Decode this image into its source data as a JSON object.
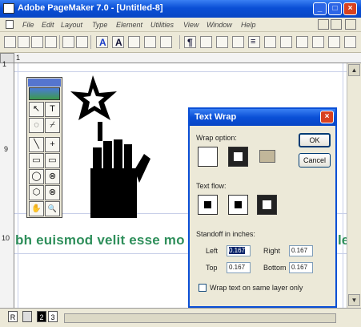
{
  "window": {
    "title": "Adobe PageMaker 7.0 - [Untitled-8]",
    "minimize_glyph": "_",
    "maximize_glyph": "□",
    "close_glyph": "×"
  },
  "menu": [
    "File",
    "Edit",
    "Layout",
    "Type",
    "Element",
    "Utilities",
    "View",
    "Window",
    "Help"
  ],
  "toolbar": {
    "glyphs": {
      "text_tool": "A",
      "bold_A": "A",
      "paragraph": "¶",
      "pilcrow_alt": "≡"
    }
  },
  "rulers": {
    "h_label": "1",
    "v_labels": [
      "1",
      "9",
      "10"
    ]
  },
  "toolbox": {
    "tools": [
      "↖",
      "T",
      "◌",
      "⌿",
      "╲",
      "+",
      "▭",
      "▭",
      "◯",
      "⊗",
      "⬡",
      "⊗",
      "✋",
      "🔍"
    ]
  },
  "document": {
    "body_text": "bh euismod velit esse mo",
    "body_text_right": "le"
  },
  "pages": {
    "labels": [
      "R",
      "2",
      "3"
    ]
  },
  "dialog": {
    "title": "Text Wrap",
    "close_glyph": "×",
    "wrap_option_label": "Wrap option:",
    "text_flow_label": "Text flow:",
    "standoff_label": "Standoff in inches:",
    "ok_label": "OK",
    "cancel_label": "Cancel",
    "fields": {
      "left": {
        "label": "Left",
        "value": "0.167"
      },
      "right": {
        "label": "Right",
        "value": "0.167"
      },
      "top": {
        "label": "Top",
        "value": "0.167"
      },
      "bottom": {
        "label": "Bottom",
        "value": "0.167"
      }
    },
    "checkbox_label": "Wrap text on same layer only",
    "checkbox_checked": false
  },
  "colors": {
    "titlebar": "#0a4fd6",
    "body_text": "#2f8f5b",
    "chrome": "#ece9d8"
  }
}
